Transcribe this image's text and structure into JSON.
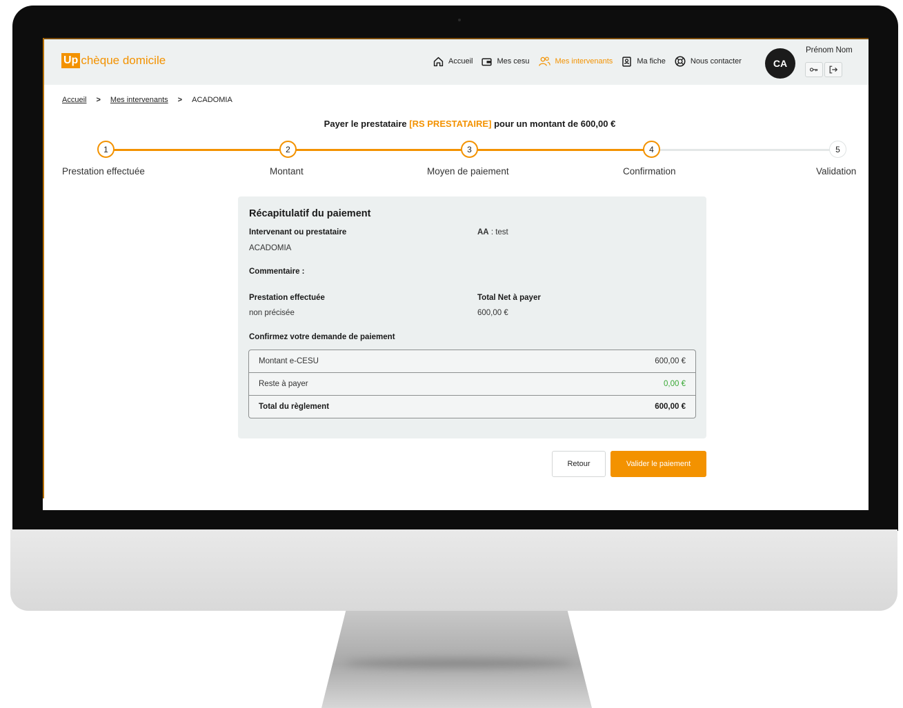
{
  "app": {
    "logo_up": "Up",
    "logo_text": "chèque domicile"
  },
  "nav": {
    "items": [
      {
        "label": "Accueil",
        "icon": "home-icon"
      },
      {
        "label": "Mes cesu",
        "icon": "wallet-icon"
      },
      {
        "label": "Mes intervenants",
        "icon": "users-icon",
        "active": true
      },
      {
        "label": "Ma fiche",
        "icon": "id-card-icon"
      },
      {
        "label": "Nous contacter",
        "icon": "lifebuoy-icon"
      }
    ]
  },
  "user": {
    "initials": "CA",
    "name": "Prénom Nom",
    "buttons": [
      "key-icon",
      "logout-icon"
    ]
  },
  "breadcrumb": [
    "Accueil",
    "Mes intervenants",
    "ACADOMIA"
  ],
  "payment_title": {
    "prefix": "Payer le prestataire",
    "provider": "[RS PRESTATAIRE]",
    "suffix": "pour un montant de 600,00 €"
  },
  "stepper": {
    "steps": [
      {
        "number": "1",
        "label": "Prestation effectuée",
        "done": true
      },
      {
        "number": "2",
        "label": "Montant",
        "done": true
      },
      {
        "number": "3",
        "label": "Moyen de paiement",
        "done": true
      },
      {
        "number": "4",
        "label": "Confirmation",
        "done": true
      },
      {
        "number": "5",
        "label": "Validation",
        "done": false
      }
    ]
  },
  "summary": {
    "title": "Récapitulatif du paiement",
    "provider_label": "Intervenant ou prestataire",
    "provider_value": "ACADOMIA",
    "aa_label": "AA",
    "aa_value": " : test",
    "comment_label": "Commentaire :",
    "service_label": "Prestation effectuée",
    "service_value": "non précisée",
    "net_label": "Total Net à payer",
    "net_value": "600,00 €",
    "confirm_label": "Confirmez votre demande de paiement",
    "rows": [
      {
        "label": "Montant e-CESU",
        "amount": "600,00  €"
      },
      {
        "label": "Reste à payer",
        "amount": "0,00  €"
      },
      {
        "label": "Total du règlement",
        "amount": "600,00  €"
      }
    ]
  },
  "actions": {
    "back_label": "Retour",
    "validate_label": "Valider le paiement"
  },
  "colors": {
    "accent": "#f39200",
    "header_bg": "#eef1f1",
    "card_bg": "#ecf0f0",
    "positive": "#39a935"
  }
}
